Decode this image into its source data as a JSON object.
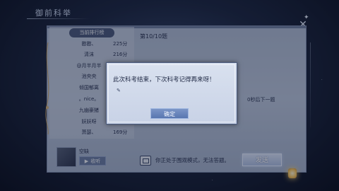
{
  "window": {
    "title": "御前科举"
  },
  "leaderboard": {
    "header": "当前排行榜",
    "rows": [
      {
        "name": "憨憨、",
        "score": "225分"
      },
      {
        "name": "清沫",
        "score": "216分"
      },
      {
        "name": "@月半月半",
        "score": ""
      },
      {
        "name": "池央央",
        "score": ""
      },
      {
        "name": "倾国郁离",
        "score": ""
      },
      {
        "name": "。nice。",
        "score": ""
      },
      {
        "name": "九幽豪猪",
        "score": ""
      },
      {
        "name": "妖妖呀",
        "score": ""
      },
      {
        "name": "萧瑟、",
        "score": "169分"
      }
    ]
  },
  "question": {
    "progress": "第10/10题",
    "countdown": "0秒后下一题"
  },
  "player": {
    "name": "空缺",
    "collapse_label": "收听"
  },
  "notice": {
    "text": "你正处于围观模式，无法答题。"
  },
  "buttons": {
    "submit": "发送"
  },
  "modal": {
    "message": "此次科考结束，下次科考记得再来呀！",
    "confirm": "确定"
  },
  "icons": {
    "close": "close-icon",
    "notice": "screen-icon",
    "lantern": "lantern-icon",
    "play": "play-icon"
  },
  "colors": {
    "accent": "#5876b0",
    "background": "#1c2742"
  }
}
